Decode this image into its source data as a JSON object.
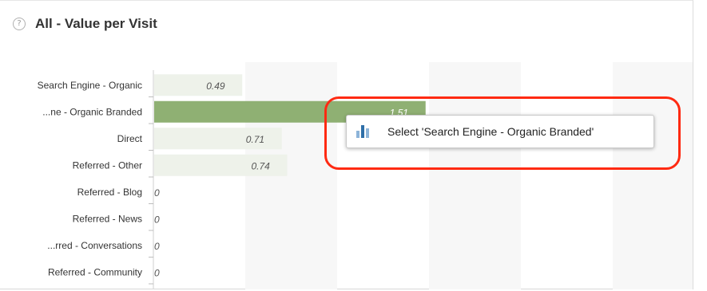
{
  "header": {
    "title": "All - Value per Visit",
    "help_icon": "question-circle-icon"
  },
  "chart_data": {
    "type": "bar",
    "orientation": "horizontal",
    "categories": [
      "Search Engine - Organic",
      "...ne - Organic Branded",
      "Direct",
      "Referred - Other",
      "Referred - Blog",
      "Referred - News",
      "...rred - Conversations",
      "Referred - Community"
    ],
    "values": [
      0.49,
      1.51,
      0.71,
      0.74,
      0,
      0,
      0,
      0
    ],
    "value_labels": [
      "0.49",
      "1.51",
      "0.71",
      "0.74",
      "0",
      "0",
      "0",
      "0"
    ],
    "xlim": [
      0,
      3
    ],
    "bar_color": "#eef2ea",
    "highlight_color": "#8fb073",
    "highlighted_index": 1,
    "grid": "alternating column bands"
  },
  "tooltip": {
    "icon": "bar-chart-icon",
    "text": "Select 'Search Engine - Organic Branded'"
  },
  "annotation": {
    "color": "#ff2a12"
  }
}
